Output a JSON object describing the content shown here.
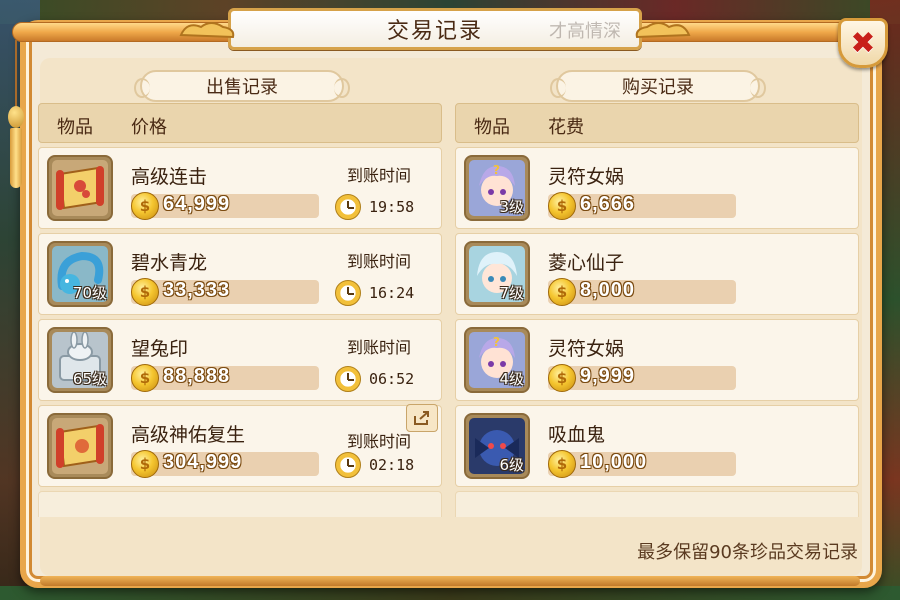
{
  "dialog": {
    "title": "交易记录",
    "title_ink": "才高情深",
    "close_symbol": "✖",
    "footer_note": "最多保留90条珍品交易记录"
  },
  "sell": {
    "section_title": "出售记录",
    "col_item": "物品",
    "col_price": "价格",
    "arrive_label": "到账时间",
    "rows": [
      {
        "name": "高级连击",
        "price": "64,999",
        "time": "19:58",
        "level": "",
        "icon": "scroll-icon"
      },
      {
        "name": "碧水青龙",
        "price": "33,333",
        "time": "16:24",
        "level": "70级",
        "icon": "dragon-icon"
      },
      {
        "name": "望兔印",
        "price": "88,888",
        "time": "06:52",
        "level": "65级",
        "icon": "rabbit-seal-icon"
      },
      {
        "name": "高级神佑复生",
        "price": "304,999",
        "time": "02:18",
        "level": "",
        "icon": "scroll-icon"
      }
    ]
  },
  "buy": {
    "section_title": "购买记录",
    "col_item": "物品",
    "col_cost": "花费",
    "rows": [
      {
        "name": "灵符女娲",
        "price": "6,666",
        "level": "3级",
        "icon": "nuwa-portrait-icon"
      },
      {
        "name": "菱心仙子",
        "price": "8,000",
        "level": "7级",
        "icon": "fairy-portrait-icon"
      },
      {
        "name": "灵符女娲",
        "price": "9,999",
        "level": "4级",
        "icon": "nuwa-portrait-icon"
      },
      {
        "name": "吸血鬼",
        "price": "10,000",
        "level": "6级",
        "icon": "vampire-portrait-icon"
      }
    ]
  },
  "colors": {
    "panel_border": "#e8a64a",
    "panel_bg": "#f4ead7",
    "coin": "#f5c630",
    "close_x": "#c8201a"
  }
}
